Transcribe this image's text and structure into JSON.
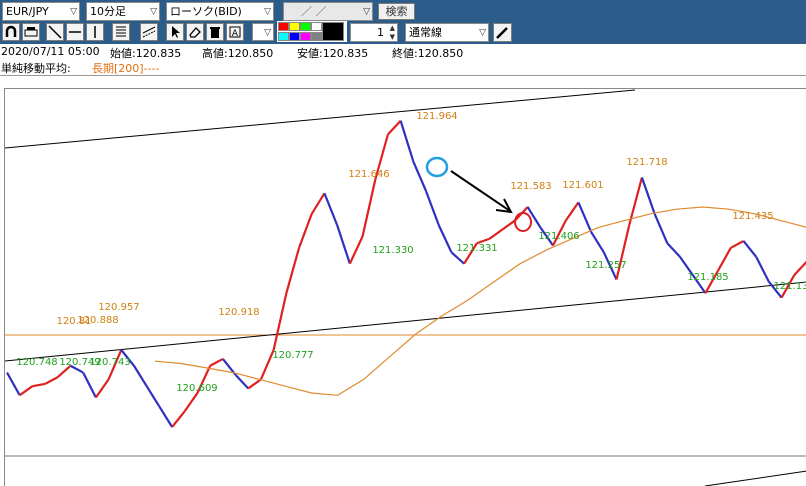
{
  "toolbar": {
    "symbol": "EUR/JPY",
    "timeframe": "10分足",
    "chart_type": "ローソク(BID)",
    "date_value": "／ ／",
    "search_button": "検索",
    "spin_value": "1",
    "line_type": "通常線",
    "colors": [
      "#ff0000",
      "#ffff00",
      "#00ff00",
      "#00ffff",
      "#0000ff",
      "#ff00ff",
      "#ffffff",
      "#000000",
      "#808080"
    ]
  },
  "info": {
    "datetime": "2020/07/11 05:00",
    "open": "始値:120.835",
    "high": "高値:120.850",
    "low": "安値:120.835",
    "close": "終値:120.850"
  },
  "indicator": {
    "label": "単純移動平均:",
    "value": "長期[200]----",
    "color": "#e07010"
  },
  "chart_data": {
    "type": "line",
    "series": [
      {
        "values": [
          120.85,
          120.75,
          120.79,
          120.8,
          120.83,
          120.88,
          120.85,
          120.74,
          120.82,
          120.95,
          120.88,
          120.79,
          120.7,
          120.61,
          120.68,
          120.76,
          120.88,
          120.91,
          120.84,
          120.78,
          120.82,
          120.95,
          121.2,
          121.4,
          121.55,
          121.64,
          121.5,
          121.33,
          121.45,
          121.7,
          121.9,
          121.96,
          121.78,
          121.65,
          121.5,
          121.38,
          121.33,
          121.42,
          121.44,
          121.48,
          121.52,
          121.58,
          121.49,
          121.41,
          121.52,
          121.6,
          121.47,
          121.38,
          121.26,
          121.5,
          121.71,
          121.55,
          121.42,
          121.36,
          121.28,
          121.2,
          121.3,
          121.4,
          121.43,
          121.36,
          121.25,
          121.18,
          121.28,
          121.34
        ]
      },
      {
        "values": [
          120.9,
          120.89,
          120.87,
          120.85,
          120.82,
          120.79,
          120.76,
          120.75,
          120.82,
          120.92,
          121.02,
          121.1,
          121.17,
          121.25,
          121.33,
          121.39,
          121.44,
          121.49,
          121.52,
          121.55,
          121.57,
          121.58,
          121.57,
          121.55,
          121.52,
          121.49
        ]
      }
    ],
    "labels": [
      {
        "text": "121.964",
        "role": "high"
      },
      {
        "text": "121.646",
        "role": "high"
      },
      {
        "text": "121.583",
        "role": "high"
      },
      {
        "text": "121.601",
        "role": "high"
      },
      {
        "text": "121.718",
        "role": "high"
      },
      {
        "text": "121.435",
        "role": "high"
      },
      {
        "text": "120.957",
        "role": "high"
      },
      {
        "text": "120.918",
        "role": "high"
      },
      {
        "text": "120.81",
        "role": "high"
      },
      {
        "text": "120.888",
        "role": "high"
      },
      {
        "text": "121.330",
        "role": "low"
      },
      {
        "text": "121.331",
        "role": "low"
      },
      {
        "text": "121.406",
        "role": "low"
      },
      {
        "text": "121.257",
        "role": "low"
      },
      {
        "text": "121.185",
        "role": "low"
      },
      {
        "text": "121.13",
        "role": "low"
      },
      {
        "text": "120.748",
        "role": "low"
      },
      {
        "text": "120.749",
        "role": "low"
      },
      {
        "text": "120.743",
        "role": "low"
      },
      {
        "text": "120.609",
        "role": "low"
      },
      {
        "text": "120.777",
        "role": "low"
      }
    ],
    "colors": {
      "high": "#d08010",
      "low": "#20a020",
      "price_up": "#e02020",
      "price_down": "#3030c0",
      "ma": "#e08a30",
      "trendline": "#000000",
      "circle_blue": "#20a0e0",
      "circle_red": "#e02020"
    }
  }
}
